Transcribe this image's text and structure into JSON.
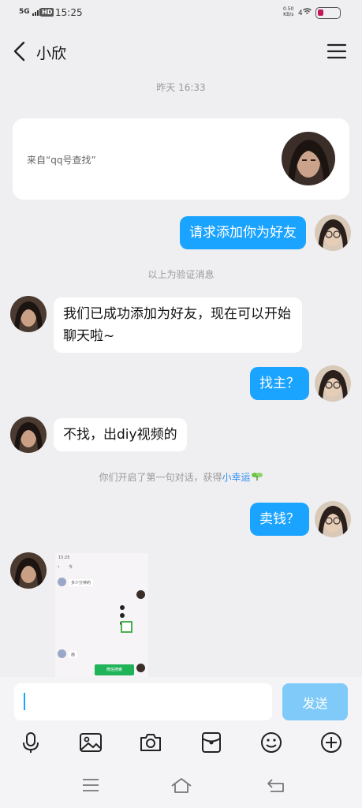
{
  "status_bar": {
    "network": "5G",
    "hd": "HD",
    "time": "15:25",
    "net_speed_value": "0.50",
    "net_speed_unit": "KB/s",
    "wifi": "4"
  },
  "header": {
    "contact_name": "小欣"
  },
  "conversation": {
    "time_separator": "昨天 16:33",
    "friend_card": {
      "source_text": "来自“qq号查找”"
    },
    "messages": [
      {
        "side": "out",
        "text": "请求添加你为好友"
      },
      {
        "side": "in",
        "text": "我们已成功添加为好友，现在可以开始聊天啦~"
      },
      {
        "side": "out",
        "text": "找主？"
      },
      {
        "side": "in",
        "text": "不找，出diy视频的"
      },
      {
        "side": "out",
        "text": "卖钱？"
      }
    ],
    "verification_note": "以上为验证消息",
    "first_chat_note": {
      "prefix": "你们开启了第一句对话，获得",
      "link": "小幸运"
    },
    "image_preview": {
      "time": "15:25",
      "chat_name": "今",
      "message_1": "多少分钟的",
      "message_2": "画",
      "button": "微信搜索"
    }
  },
  "composer": {
    "input_value": "",
    "send_label": "发送"
  },
  "toolbar": {
    "icons": [
      "microphone-icon",
      "image-icon",
      "camera-icon",
      "red-packet-icon",
      "emoji-icon",
      "plus-icon"
    ]
  },
  "system_nav": {
    "icons": [
      "menu-icon",
      "home-icon",
      "back-icon"
    ]
  },
  "colors": {
    "accent": "#1aa3ff",
    "send_disabled": "#7fcaf8",
    "background": "#efeff1"
  }
}
